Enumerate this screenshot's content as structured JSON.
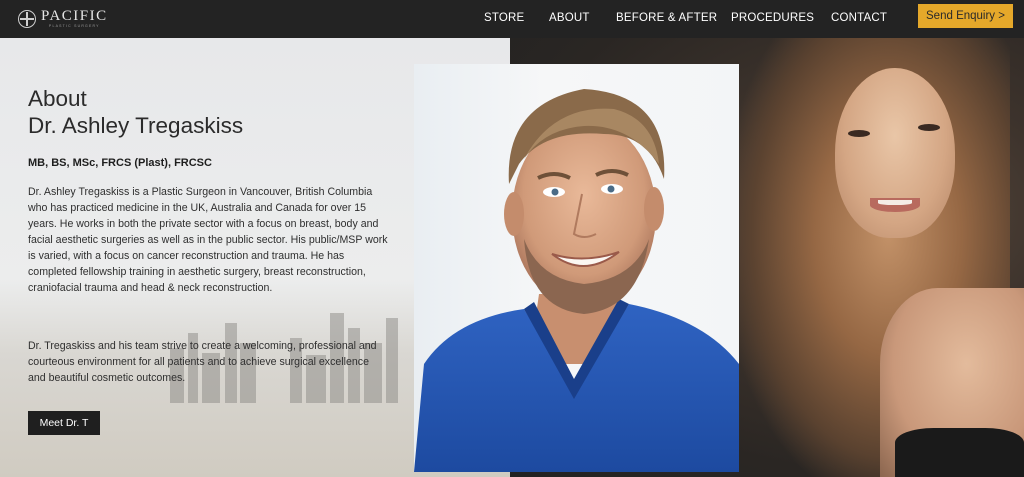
{
  "header": {
    "logo_word": "PACIFIC",
    "logo_sub": "PLASTIC SURGERY",
    "nav": [
      "STORE",
      "ABOUT",
      "BEFORE & AFTER",
      "PROCEDURES",
      "CONTACT"
    ],
    "cta": "Send Enquiry >"
  },
  "about": {
    "heading_line1": "About",
    "heading_line2": "Dr. Ashley Tregaskiss",
    "credentials": "MB, BS, MSc, FRCS (Plast), FRCSC",
    "paragraph1": "Dr. Ashley Tregaskiss is a Plastic Surgeon in Vancouver, British Columbia who has practiced medicine in the UK, Australia and Canada for over 15 years. He works in both the private sector with a focus on breast, body and facial aesthetic surgeries as well as in the public sector. His public/MSP work is varied, with a focus on cancer reconstruction and trauma. He has completed fellowship training in aesthetic surgery, breast reconstruction, craniofacial trauma and head & neck reconstruction.",
    "paragraph2": "Dr. Tregaskiss and his team strive to create a welcoming, professional and courteous environment for all patients and to achieve surgical excellence and beautiful cosmetic outcomes.",
    "button": "Meet Dr. T"
  },
  "colors": {
    "nav_bg": "#232323",
    "accent": "#e5a82a",
    "button_dark": "#1f1f1f",
    "scrubs_blue": "#2456b3"
  }
}
